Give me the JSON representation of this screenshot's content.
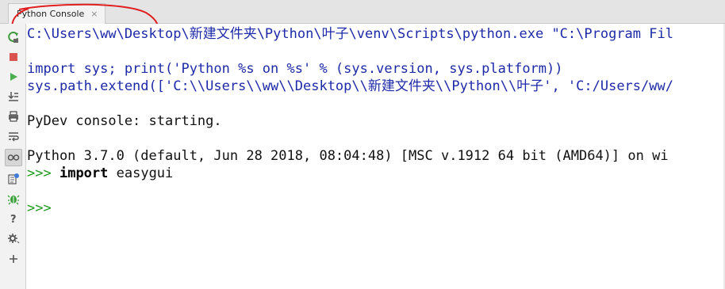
{
  "tab": {
    "title": "Python Console",
    "close": "×"
  },
  "toolbar": {
    "items": [
      {
        "name": "rerun-icon"
      },
      {
        "name": "stop-icon",
        "color": "#d9534f"
      },
      {
        "name": "run-icon",
        "color": "#4caf50"
      },
      {
        "name": "scroll-to-end-icon"
      },
      {
        "name": "print-icon"
      },
      {
        "name": "soft-wrap-icon"
      },
      {
        "name": "show-variables-icon"
      },
      {
        "name": "settings-file-icon"
      },
      {
        "name": "debug-icon",
        "color": "#3aa13a"
      },
      {
        "name": "help-icon"
      },
      {
        "name": "gear-icon"
      },
      {
        "name": "add-icon"
      }
    ]
  },
  "console": {
    "line1": "C:\\Users\\ww\\Desktop\\新建文件夹\\Python\\叶子\\venv\\Scripts\\python.exe \"C:\\Program Fil",
    "line2": "import sys; print('Python %s on %s' % (sys.version, sys.platform))",
    "line3": "sys.path.extend(['C:\\\\Users\\\\ww\\\\Desktop\\\\新建文件夹\\\\Python\\\\叶子', 'C:/Users/ww/",
    "line4": "PyDev console: starting.",
    "line5": "Python 3.7.0 (default, Jun 28 2018, 08:04:48) [MSC v.1912 64 bit (AMD64)] on wi",
    "prompt": ">>>",
    "keyword": "import",
    "module": " easygui",
    "prompt2": ">>>"
  },
  "colors": {
    "command": "#1d2aa8",
    "prompt": "#1a9b1a",
    "annotation": "#e02020"
  }
}
